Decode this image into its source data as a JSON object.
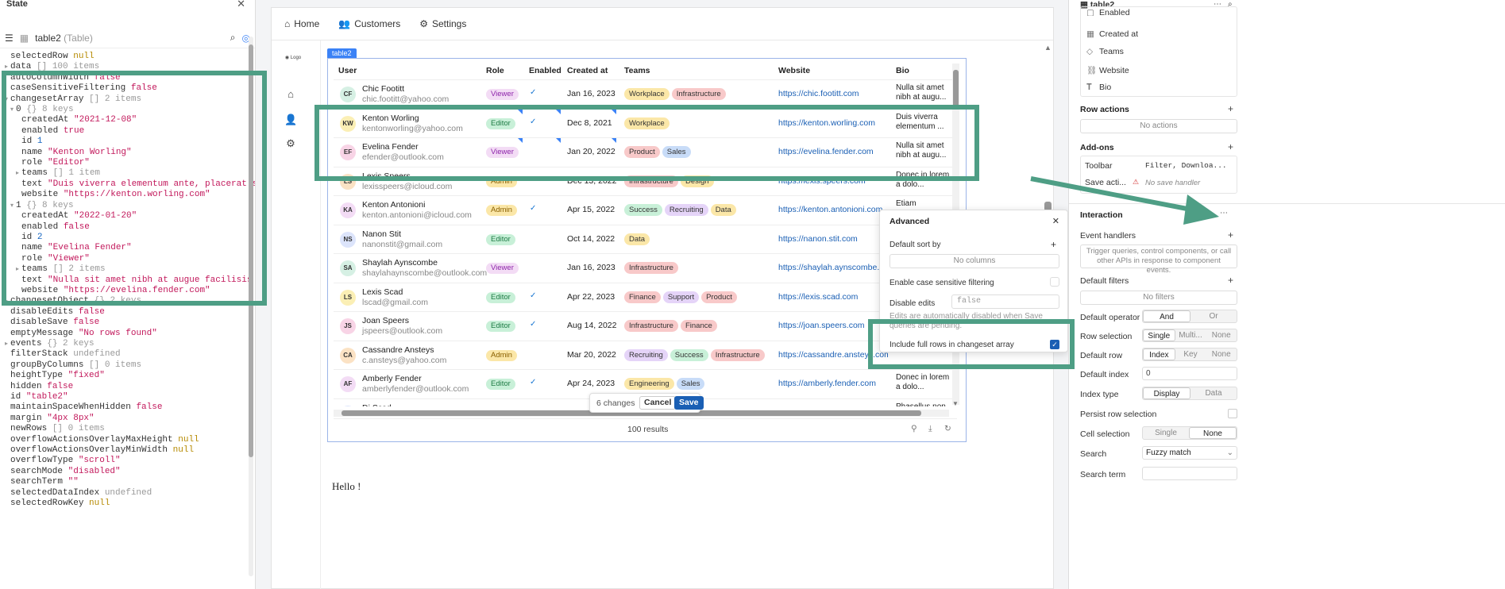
{
  "state_panel": {
    "title": "State",
    "component": "table2",
    "component_type": "(Table)",
    "tree": [
      {
        "ind": 0,
        "tw": "",
        "k": "selectedRow",
        "v": "null",
        "c": "nl"
      },
      {
        "ind": 0,
        "tw": "▸",
        "k": "data",
        "v": "[] 100 items",
        "c": "meta"
      },
      {
        "ind": 0,
        "tw": "",
        "k": "autoColumnWidth",
        "v": "false",
        "c": "kw"
      },
      {
        "ind": 0,
        "tw": "",
        "k": "caseSensitiveFiltering",
        "v": "false",
        "c": "kw"
      },
      {
        "ind": 0,
        "tw": "▾",
        "k": "changesetArray",
        "v": "[] 2 items",
        "c": "meta"
      },
      {
        "ind": 1,
        "tw": "▾",
        "k": "0",
        "v": "{} 8 keys",
        "c": "meta"
      },
      {
        "ind": 2,
        "tw": "",
        "k": "createdAt",
        "v": "\"2021-12-08\"",
        "c": "str"
      },
      {
        "ind": 2,
        "tw": "",
        "k": "enabled",
        "v": "true",
        "c": "kw"
      },
      {
        "ind": 2,
        "tw": "",
        "k": "id",
        "v": "1",
        "c": "num"
      },
      {
        "ind": 2,
        "tw": "",
        "k": "name",
        "v": "\"Kenton Worling\"",
        "c": "str"
      },
      {
        "ind": 2,
        "tw": "",
        "k": "role",
        "v": "\"Editor\"",
        "c": "str"
      },
      {
        "ind": 2,
        "tw": "▸",
        "k": "teams",
        "v": "[] 1 item",
        "c": "meta"
      },
      {
        "ind": 2,
        "tw": "",
        "k": "text",
        "v": "\"Duis viverra elementum ante, placerat sollici…",
        "c": "str"
      },
      {
        "ind": 2,
        "tw": "",
        "k": "website",
        "v": "\"https://kenton.worling.com\"",
        "c": "str"
      },
      {
        "ind": 1,
        "tw": "▾",
        "k": "1",
        "v": "{} 8 keys",
        "c": "meta"
      },
      {
        "ind": 2,
        "tw": "",
        "k": "createdAt",
        "v": "\"2022-01-20\"",
        "c": "str"
      },
      {
        "ind": 2,
        "tw": "",
        "k": "enabled",
        "v": "false",
        "c": "kw"
      },
      {
        "ind": 2,
        "tw": "",
        "k": "id",
        "v": "2",
        "c": "num"
      },
      {
        "ind": 2,
        "tw": "",
        "k": "name",
        "v": "\"Evelina Fender\"",
        "c": "str"
      },
      {
        "ind": 2,
        "tw": "",
        "k": "role",
        "v": "\"Viewer\"",
        "c": "str"
      },
      {
        "ind": 2,
        "tw": "▸",
        "k": "teams",
        "v": "[] 2 items",
        "c": "meta"
      },
      {
        "ind": 2,
        "tw": "",
        "k": "text",
        "v": "\"Nulla sit amet nibh at augue facilisis viverr…",
        "c": "str"
      },
      {
        "ind": 2,
        "tw": "",
        "k": "website",
        "v": "\"https://evelina.fender.com\"",
        "c": "str"
      },
      {
        "ind": 0,
        "tw": "▸",
        "k": "changesetObject",
        "v": "{} 2 keys",
        "c": "meta"
      },
      {
        "ind": 0,
        "tw": "",
        "k": "disableEdits",
        "v": "false",
        "c": "kw"
      },
      {
        "ind": 0,
        "tw": "",
        "k": "disableSave",
        "v": "false",
        "c": "kw"
      },
      {
        "ind": 0,
        "tw": "",
        "k": "emptyMessage",
        "v": "\"No rows found\"",
        "c": "str"
      },
      {
        "ind": 0,
        "tw": "▸",
        "k": "events",
        "v": "{} 2 keys",
        "c": "meta"
      },
      {
        "ind": 0,
        "tw": "",
        "k": "filterStack",
        "v": "undefined",
        "c": "meta"
      },
      {
        "ind": 0,
        "tw": "",
        "k": "groupByColumns",
        "v": "[] 0 items",
        "c": "meta"
      },
      {
        "ind": 0,
        "tw": "",
        "k": "heightType",
        "v": "\"fixed\"",
        "c": "str"
      },
      {
        "ind": 0,
        "tw": "",
        "k": "hidden",
        "v": "false",
        "c": "kw"
      },
      {
        "ind": 0,
        "tw": "",
        "k": "id",
        "v": "\"table2\"",
        "c": "str"
      },
      {
        "ind": 0,
        "tw": "",
        "k": "maintainSpaceWhenHidden",
        "v": "false",
        "c": "kw"
      },
      {
        "ind": 0,
        "tw": "",
        "k": "margin",
        "v": "\"4px 8px\"",
        "c": "str"
      },
      {
        "ind": 0,
        "tw": "",
        "k": "newRows",
        "v": "[] 0 items",
        "c": "meta"
      },
      {
        "ind": 0,
        "tw": "",
        "k": "overflowActionsOverlayMaxHeight",
        "v": "null",
        "c": "nl"
      },
      {
        "ind": 0,
        "tw": "",
        "k": "overflowActionsOverlayMinWidth",
        "v": "null",
        "c": "nl"
      },
      {
        "ind": 0,
        "tw": "",
        "k": "overflowType",
        "v": "\"scroll\"",
        "c": "str"
      },
      {
        "ind": 0,
        "tw": "",
        "k": "searchMode",
        "v": "\"disabled\"",
        "c": "str"
      },
      {
        "ind": 0,
        "tw": "",
        "k": "searchTerm",
        "v": "\"\"",
        "c": "str"
      },
      {
        "ind": 0,
        "tw": "",
        "k": "selectedDataIndex",
        "v": "undefined",
        "c": "meta"
      },
      {
        "ind": 0,
        "tw": "",
        "k": "selectedRowKey",
        "v": "null",
        "c": "nl"
      }
    ]
  },
  "nav": {
    "home": "Home",
    "customers": "Customers",
    "settings": "Settings",
    "logo": "Logo"
  },
  "table": {
    "tag": "table2",
    "headers": [
      "User",
      "Role",
      "Enabled",
      "Created at",
      "Teams",
      "Website",
      "Bio"
    ],
    "rows": [
      {
        "ini": "CF",
        "name": "Chic Footitt",
        "email": "chic.footitt@yahoo.com",
        "role": "Viewer",
        "en": true,
        "date": "Jan 16, 2023",
        "teams": [
          "Workplace",
          "Infrastructure"
        ],
        "web": "https://chic.footitt.com",
        "bio": "Nulla  sit amet nibh at augu..."
      },
      {
        "ini": "KW",
        "name": "Kenton Worling",
        "email": "kentonworling@yahoo.com",
        "role": "Editor",
        "en": true,
        "date": "Dec 8, 2021",
        "teams": [
          "Workplace"
        ],
        "web": "https://kenton.worling.com",
        "bio": "Duis  viverra elementum ..."
      },
      {
        "ini": "EF",
        "name": "Evelina Fender",
        "email": "efender@outlook.com",
        "role": "Viewer",
        "en": false,
        "date": "Jan 20, 2022",
        "teams": [
          "Product",
          "Sales"
        ],
        "web": "https://evelina.fender.com",
        "bio": "Nulla sit amet nibh at augu..."
      },
      {
        "ini": "LS",
        "name": "Lexis Speers",
        "email": "lexisspeers@icloud.com",
        "role": "Admin",
        "en": true,
        "date": "Dec 13, 2022",
        "teams": [
          "Infrastructure",
          "Design"
        ],
        "web": "https://lexis.speers.com",
        "bio": "Donec in lorem a dolo..."
      },
      {
        "ini": "KA",
        "name": "Kenton Antonioni",
        "email": "kenton.antonioni@icloud.com",
        "role": "Admin",
        "en": true,
        "date": "Apr 15, 2022",
        "teams": [
          "Success",
          "Recruiting",
          "Data"
        ],
        "web": "https://kenton.antonioni.com",
        "bio": "Etiam"
      },
      {
        "ini": "NS",
        "name": "Nanon Stit",
        "email": "nanonstit@gmail.com",
        "role": "Editor",
        "en": false,
        "date": "Oct 14, 2022",
        "teams": [
          "Data"
        ],
        "web": "https://nanon.stit.com",
        "bio": ""
      },
      {
        "ini": "SA",
        "name": "Shaylah Aynscombe",
        "email": "shaylahaynscombe@outlook.com",
        "role": "Viewer",
        "en": false,
        "date": "Jan 16, 2023",
        "teams": [
          "Infrastructure"
        ],
        "web": "https://shaylah.aynscombe.co",
        "bio": ""
      },
      {
        "ini": "LS",
        "name": "Lexis Scad",
        "email": "lscad@gmail.com",
        "role": "Editor",
        "en": true,
        "date": "Apr 22, 2023",
        "teams": [
          "Finance",
          "Support",
          "Product"
        ],
        "web": "https://lexis.scad.com",
        "bio": ""
      },
      {
        "ini": "JS",
        "name": "Joan Speers",
        "email": "jspeers@outlook.com",
        "role": "Editor",
        "en": true,
        "date": "Aug 14, 2022",
        "teams": [
          "Infrastructure",
          "Finance"
        ],
        "web": "https://joan.speers.com",
        "bio": ""
      },
      {
        "ini": "CA",
        "name": "Cassandre Ansteys",
        "email": "c.ansteys@yahoo.com",
        "role": "Admin",
        "en": false,
        "date": "Mar 20, 2022",
        "teams": [
          "Recruiting",
          "Success",
          "Infrastructure"
        ],
        "web": "https://cassandre.ansteys.com",
        "bio": ""
      },
      {
        "ini": "AF",
        "name": "Amberly Fender",
        "email": "amberlyfender@outlook.com",
        "role": "Editor",
        "en": true,
        "date": "Apr 24, 2023",
        "teams": [
          "Engineering",
          "Sales"
        ],
        "web": "https://amberly.fender.com",
        "bio": "Donec in lorem a dolo..."
      },
      {
        "ini": "DS",
        "name": "Di Scad",
        "email": "",
        "role": "",
        "en": false,
        "date": "",
        "teams": [],
        "web": "",
        "bio": "Phasellus non"
      }
    ],
    "footer": "100 results",
    "changes": "6 changes",
    "cancel": "Cancel",
    "save": "Save"
  },
  "hello": "Hello !",
  "advanced": {
    "title": "Advanced",
    "default_sort": "Default sort by",
    "no_columns": "No columns",
    "case_sensitive": "Enable case sensitive filtering",
    "disable_edits": "Disable edits",
    "disable_edits_value": "false",
    "hint": "Edits are automatically disabled when Save queries are pending.",
    "include_full": "Include full rows in changeset array"
  },
  "right": {
    "title": "table2",
    "columns": [
      "Enabled",
      "Created at",
      "Teams",
      "Website",
      "Bio"
    ],
    "row_actions": "Row actions",
    "no_actions": "No actions",
    "addons": "Add-ons",
    "toolbar": "Toolbar",
    "toolbar_value": "Filter, Downloa...",
    "save_actions": "Save acti...",
    "save_value": "No save handler",
    "interaction": "Interaction",
    "event_handlers": "Event handlers",
    "event_hint": "Trigger queries, control components, or call other APIs in response to component events.",
    "default_filters": "Default filters",
    "no_filters": "No filters",
    "default_operator": "Default operator",
    "op": [
      "And",
      "Or"
    ],
    "row_selection": "Row selection",
    "rs": [
      "Single",
      "Multi...",
      "None"
    ],
    "default_row": "Default row",
    "dr": [
      "Index",
      "Key",
      "None"
    ],
    "default_index": "Default index",
    "default_index_value": "0",
    "index_type": "Index type",
    "it": [
      "Display",
      "Data"
    ],
    "persist": "Persist row selection",
    "cell_selection": "Cell selection",
    "cs": [
      "Single",
      "None"
    ],
    "search": "Search",
    "search_value": "Fuzzy match",
    "search_term": "Search term"
  },
  "colors": {
    "accent": "#4e9e85",
    "primary": "#1a5fb4"
  }
}
